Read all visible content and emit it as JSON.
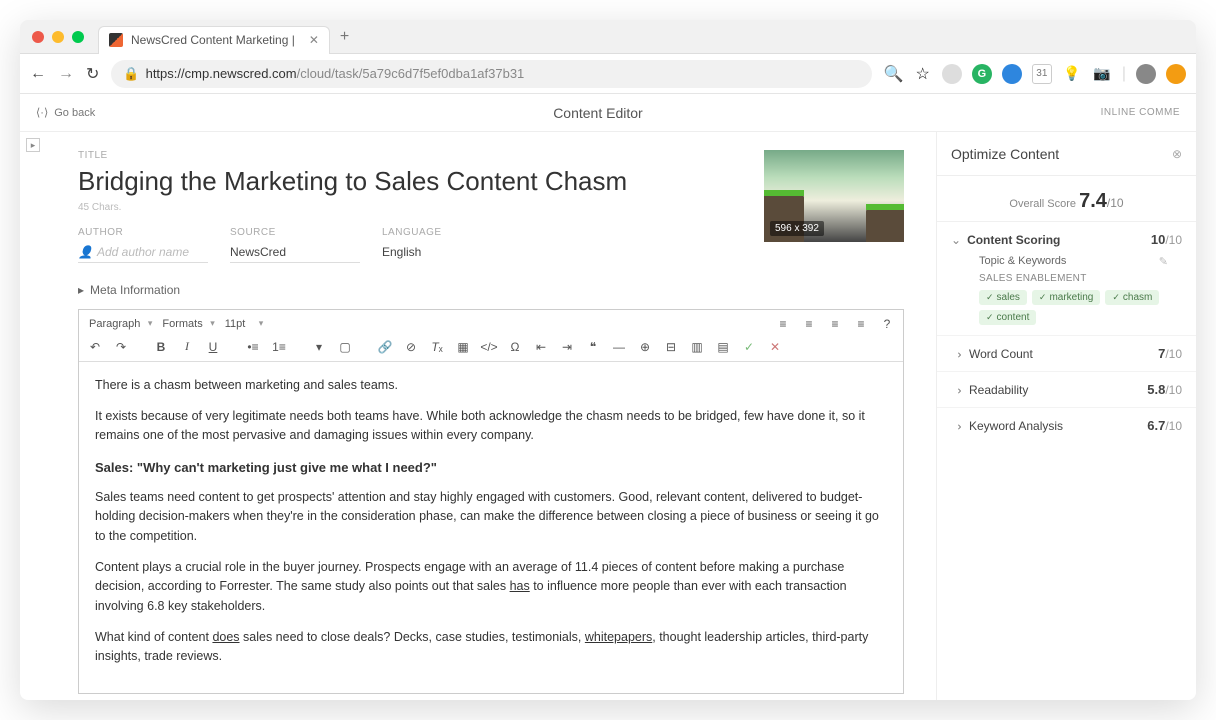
{
  "browser": {
    "tab_title": "NewsCred Content Marketing |",
    "url_host": "https://cmp.newscred.com",
    "url_path": "/cloud/task/5a79c6d7f5ef0dba1af37b31"
  },
  "appbar": {
    "go_back": "Go back",
    "title": "Content Editor",
    "inline_comments": "INLINE COMME"
  },
  "title_section": {
    "label": "TITLE",
    "title": "Bridging the Marketing to Sales Content Chasm",
    "chars": "45 Chars.",
    "thumb_dim": "596 x 392"
  },
  "meta": {
    "author_label": "AUTHOR",
    "author_placeholder": "Add author name",
    "source_label": "SOURCE",
    "source_value": "NewsCred",
    "language_label": "LANGUAGE",
    "language_value": "English",
    "meta_info": "Meta Information"
  },
  "toolbar": {
    "paragraph": "Paragraph",
    "formats": "Formats",
    "fontsize": "11pt"
  },
  "body": {
    "p1": "There is a chasm between marketing and sales teams.",
    "p2": "It exists because of very legitimate needs both teams have. While both acknowledge the chasm needs to be bridged, few have done it, so it remains one of the most pervasive and damaging issues within every company.",
    "h1": "Sales: \"Why can't marketing just give me what I need?\"",
    "p3": "Sales teams need content to get prospects' attention and stay highly engaged with customers. Good, relevant content, delivered to budget-holding decision-makers when they're in the consideration phase, can make the difference between closing a piece of business or seeing it go to the competition.",
    "p4a": "Content plays a crucial role in the buyer journey. Prospects engage with an average of 11.4 pieces of content before making a purchase decision, according to Forrester. The same study also points out that sales ",
    "p4u": "has",
    "p4b": " to influence more people than ever with each transaction involving 6.8 key stakeholders.",
    "p5a": "What kind of content ",
    "p5u1": "does",
    "p5b": " sales need to close deals? Decks, case studies, testimonials, ",
    "p5u2": "whitepapers",
    "p5c": ", thought leadership articles, third-party insights, trade reviews."
  },
  "side": {
    "title": "Optimize Content",
    "overall_label": "Overall Score",
    "overall_score": "7.4",
    "overall_max": "/10",
    "content_scoring": "Content Scoring",
    "content_score": "10",
    "content_max": "/10",
    "topic_label": "Topic & Keywords",
    "enablement": "SALES ENABLEMENT",
    "tags": [
      "sales",
      "marketing",
      "chasm",
      "content"
    ],
    "word_count_label": "Word Count",
    "word_count_score": "7",
    "word_count_max": "/10",
    "readability_label": "Readability",
    "readability_score": "5.8",
    "readability_max": "/10",
    "keyword_label": "Keyword Analysis",
    "keyword_score": "6.7",
    "keyword_max": "/10"
  }
}
